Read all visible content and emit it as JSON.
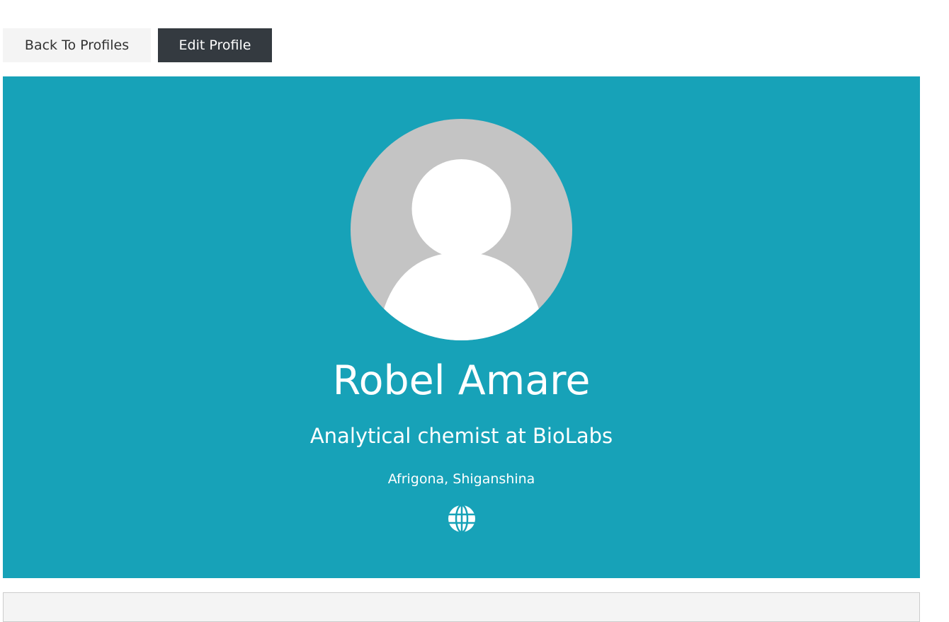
{
  "toolbar": {
    "back_label": "Back To Profiles",
    "edit_label": "Edit Profile"
  },
  "profile": {
    "name": "Robel Amare",
    "headline": "Analytical chemist at BioLabs",
    "location": "Afrigona, Shiganshina",
    "avatar_icon": "default-user-avatar",
    "website_icon": "globe-icon"
  },
  "colors": {
    "banner": "#17a2b8",
    "dark_button": "#343a40",
    "light_button": "#f4f4f4",
    "avatar_bg": "#c4c4c4"
  }
}
